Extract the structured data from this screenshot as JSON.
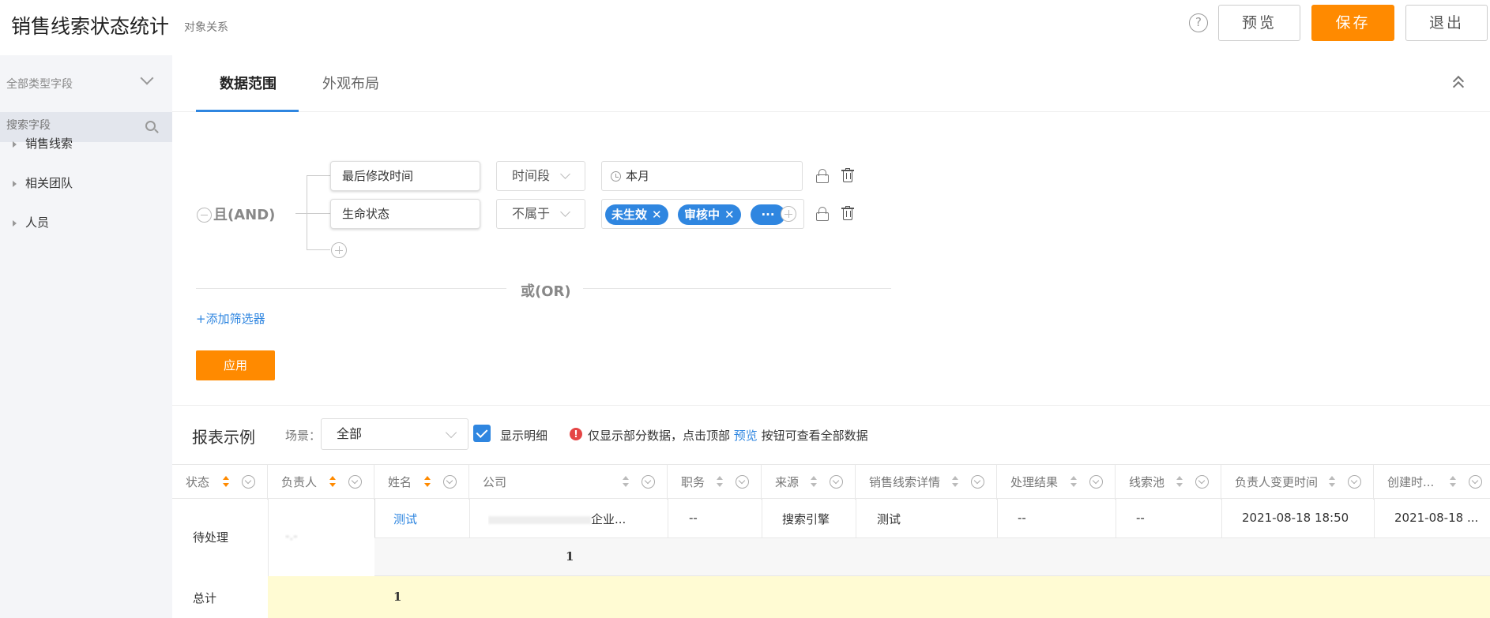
{
  "header": {
    "title": "销售线索状态统计",
    "subtitle": "对象关系",
    "help": "?",
    "preview_label": "预览",
    "save_label": "保存",
    "exit_label": "退出"
  },
  "sidebar": {
    "type_select": "全部类型字段",
    "search_placeholder": "搜索字段",
    "items": [
      {
        "label": "销售线索"
      },
      {
        "label": "相关团队"
      },
      {
        "label": "人员"
      }
    ]
  },
  "tabs": [
    {
      "label": "数据范围",
      "active": true
    },
    {
      "label": "外观布局",
      "active": false
    }
  ],
  "filter": {
    "and_label": "且(AND)",
    "or_label": "或(OR)",
    "conditions": [
      {
        "field": "最后修改时间",
        "operator": "时间段",
        "value": "本月"
      },
      {
        "field": "生命状态",
        "operator": "不属于",
        "chips": [
          "未生效",
          "审核中"
        ],
        "more": "···"
      }
    ],
    "add_filter_label": "+添加筛选器",
    "apply_label": "应用"
  },
  "report": {
    "title": "报表示例",
    "scene_label": "场景：",
    "scene_value": "全部",
    "show_detail_label": "显示明细",
    "show_detail_checked": true,
    "warn_icon": "!",
    "warn_prefix": "仅显示部分数据，点击顶部",
    "warn_link": "预览",
    "warn_suffix": "按钮可查看全部数据",
    "columns": [
      "状态",
      "负责人",
      "姓名",
      "公司",
      "职务",
      "来源",
      "销售线索详情",
      "处理结果",
      "线索池",
      "负责人变更时间",
      "创建时..."
    ],
    "row": {
      "status": "待处理",
      "owner": "-.-",
      "name": "测试",
      "company": "企业...",
      "title": "--",
      "source": "搜索引擎",
      "detail": "测试",
      "result": "--",
      "pool": "--",
      "owner_change_time": "2021-08-18 18:50",
      "created": "2021-08-18 ..."
    },
    "subtotal": "1",
    "total_label": "总计",
    "total_value": "1"
  },
  "colors": {
    "accent_orange": "#ff8a00",
    "accent_blue": "#2f86e0",
    "total_row_bg": "#fffbd3"
  }
}
